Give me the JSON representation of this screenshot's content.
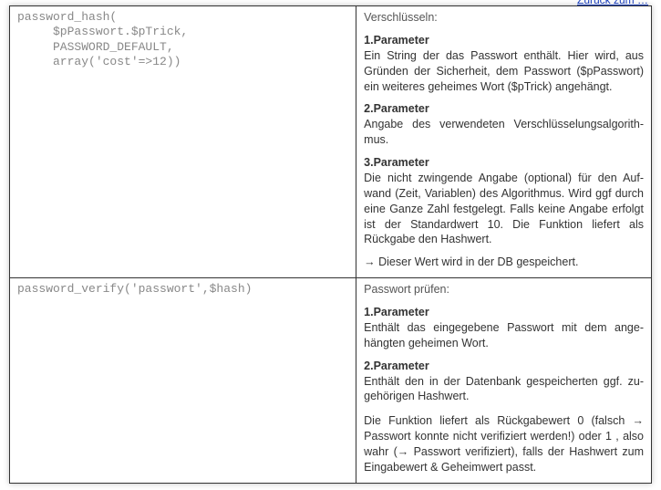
{
  "toplink": "Zurück zum …",
  "rows": [
    {
      "code": "password_hash(\n     $pPasswort.$pTrick,\n     PASSWORD_DEFAULT,\n     array('cost'=>12))",
      "heading": "Verschlüsseln:",
      "p1_label": "1.Parameter",
      "p1_text": "Ein String der das Passwort enthält. Hier wird, aus Gründen der Sicherheit, dem Passwort ($pPasswort) ein weiteres geheimes Wort ($pTrick) angehängt.",
      "p2_label": "2.Parameter",
      "p2_text": "Angabe des verwendeten Verschlüsselungsalgorith-​mus.",
      "p3_label": "3.Parameter",
      "p3_text": "Die nicht zwingende Angabe (optional) für den Auf-​wand (Zeit, Variablen) des Algorithmus.  Wird ggf durch eine Ganze Zahl festgelegt. Falls keine Angabe erfolgt ist der Standardwert 10. Die Funktion liefert als Rückgabe den Hashwert.",
      "note": "→ Dieser Wert wird in der DB gespeichert."
    },
    {
      "code": "password_verify('passwort',$hash)",
      "heading": "Passwort prüfen:",
      "p1_label": "1.Parameter",
      "p1_text": "Enthält das eingegebene Passwort mit dem ange-​hängten geheimen Wort.",
      "p2_label": "2.Parameter",
      "p2_text": "Enthält den in der Datenbank gespeicherten ggf. zu-​gehörigen Hashwert.",
      "result": "Die Funktion liefert als Rückgabewert 0 (falsch → Passwort konnte nicht verifiziert werden!) oder 1 , also wahr (→ Passwort verifiziert), falls der Hashwert zum Eingabewert & Geheimwert passt."
    }
  ]
}
